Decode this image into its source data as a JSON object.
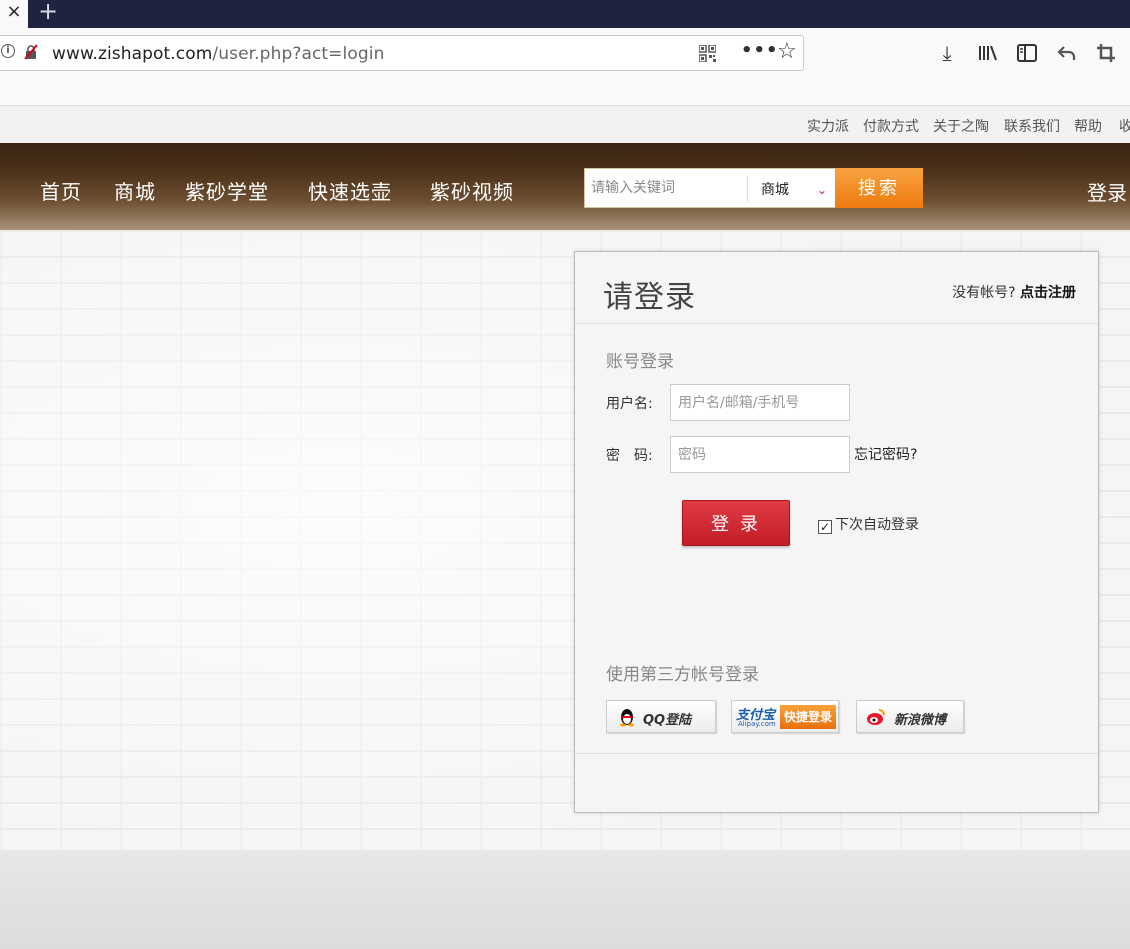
{
  "browser": {
    "tab_close_glyph": "×",
    "new_tab_glyph": "+",
    "url": {
      "host": "www.zishapot.com",
      "path": "/user.php?act=login"
    },
    "more_glyph": "•••"
  },
  "top_links": [
    "实力派",
    "付款方式",
    "关于之陶",
    "联系我们",
    "帮助",
    "收"
  ],
  "nav": {
    "items": [
      "首页",
      "商城",
      "紫砂学堂",
      "快速选壶",
      "紫砂视频"
    ],
    "search": {
      "placeholder": "请输入关键词",
      "scope": "商城",
      "button": "搜索"
    },
    "login": "登录"
  },
  "login_card": {
    "title": "请登录",
    "no_account": "没有帐号?",
    "register": "点击注册",
    "account_login": "账号登录",
    "username_label": "用户名:",
    "username_placeholder": "用户名/邮箱/手机号",
    "password_label": "密　码:",
    "password_placeholder": "密码",
    "forgot": "忘记密码?",
    "submit": "登 录",
    "remember": "下次自动登录",
    "remember_checked": true,
    "third_party_title": "使用第三方帐号登录",
    "third_party": [
      {
        "label": "QQ登陆",
        "icon": "qq-penguin-icon"
      },
      {
        "label": "快捷登录",
        "brand": "支付宝",
        "brand_sub": "Alipay.com",
        "icon": "alipay-icon"
      },
      {
        "label": "新浪微博",
        "icon": "weibo-icon"
      }
    ]
  },
  "colors": {
    "header_dark": "#3a2412",
    "search_button": "#ef7a10",
    "login_button": "#c21d27",
    "tab_strip": "#1f2340"
  }
}
